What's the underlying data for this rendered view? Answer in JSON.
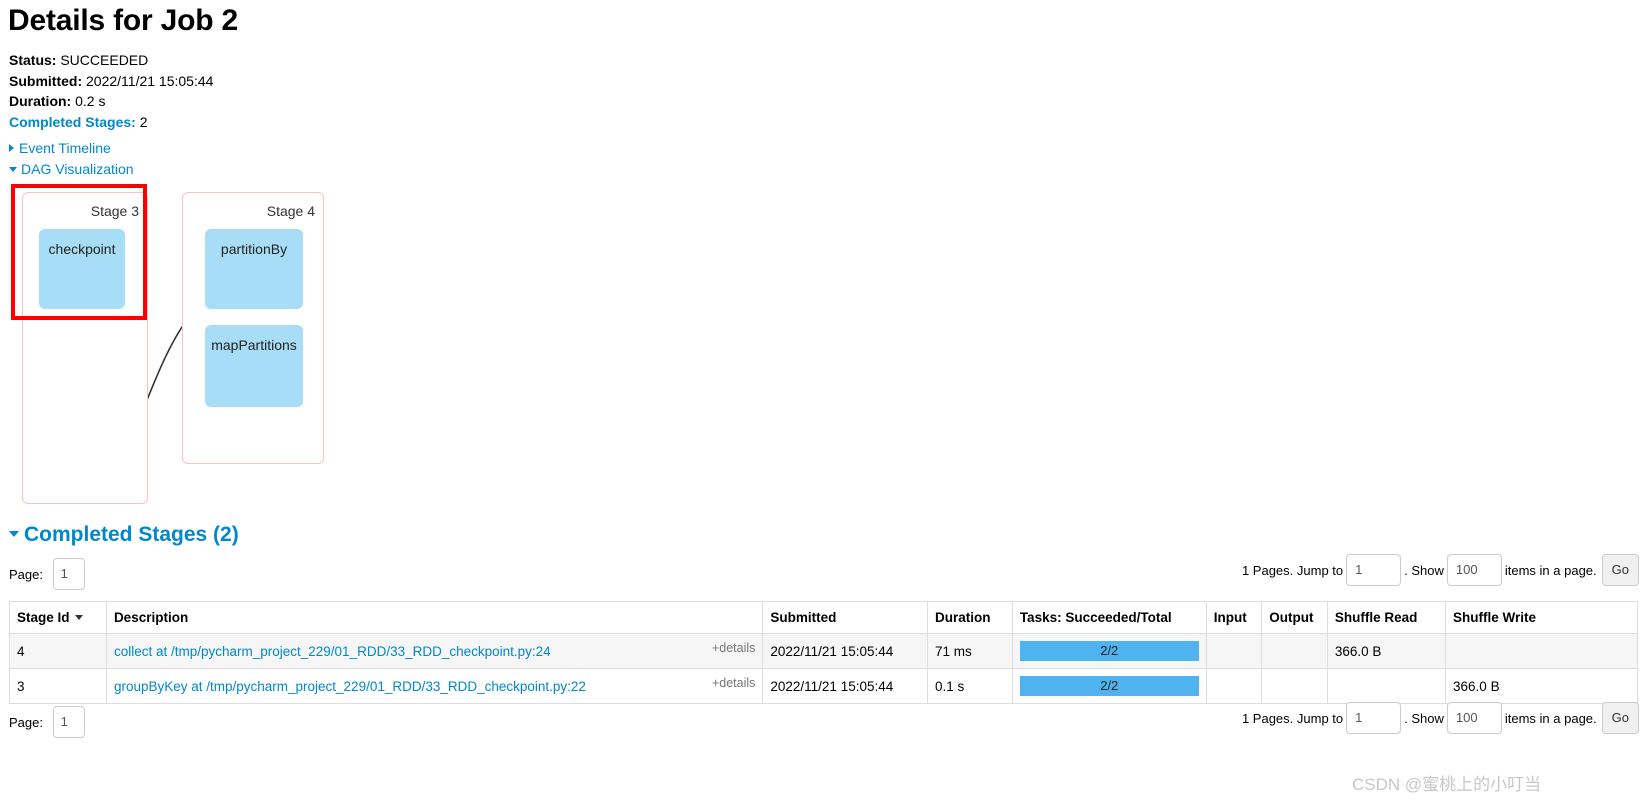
{
  "header": {
    "title": "Details for Job 2",
    "status_label": "Status:",
    "status_value": "SUCCEEDED",
    "submitted_label": "Submitted:",
    "submitted_value": "2022/11/21 15:05:44",
    "duration_label": "Duration:",
    "duration_value": "0.2 s",
    "completed_stages_label": "Completed Stages:",
    "completed_stages_value": "2"
  },
  "links": {
    "event_timeline": "Event Timeline",
    "dag_visualization": "DAG Visualization"
  },
  "dag": {
    "stages": [
      {
        "label": "Stage 3",
        "nodes": [
          {
            "label": "checkpoint"
          }
        ]
      },
      {
        "label": "Stage 4",
        "nodes": [
          {
            "label": "partitionBy"
          },
          {
            "label": "mapPartitions"
          }
        ]
      }
    ],
    "highlight_color": "#ff0000",
    "node_color": "#a7ddf7",
    "stage_border_color": "#fbbfc4"
  },
  "completed_stages_section": {
    "header": "Completed Stages (2)",
    "page_label": "Page:",
    "page_value": "1",
    "pager": {
      "pages_text": "1 Pages. Jump to",
      "jump_value": "1",
      "show_text": ". Show",
      "show_value": "100",
      "items_text": "items in a page.",
      "go_label": "Go"
    },
    "columns": [
      "Stage Id",
      "Description",
      "Submitted",
      "Duration",
      "Tasks: Succeeded/Total",
      "Input",
      "Output",
      "Shuffle Read",
      "Shuffle Write"
    ],
    "rows": [
      {
        "stage_id": "4",
        "description": "collect at /tmp/pycharm_project_229/01_RDD/33_RDD_checkpoint.py:24",
        "details": "+details",
        "submitted": "2022/11/21 15:05:44",
        "duration": "71 ms",
        "tasks": "2/2",
        "tasks_percent": 100,
        "input": "",
        "output": "",
        "shuffle_read": "366.0 B",
        "shuffle_write": ""
      },
      {
        "stage_id": "3",
        "description": "groupByKey at /tmp/pycharm_project_229/01_RDD/33_RDD_checkpoint.py:22",
        "details": "+details",
        "submitted": "2022/11/21 15:05:44",
        "duration": "0.1 s",
        "tasks": "2/2",
        "tasks_percent": 100,
        "input": "",
        "output": "",
        "shuffle_read": "",
        "shuffle_write": "366.0 B"
      }
    ]
  },
  "watermark": "CSDN @蜜桃上的小叮当",
  "colors": {
    "link": "#0088cc",
    "progress": "#4fb3ef",
    "node": "#a7ddf7",
    "highlight": "#ff0000"
  }
}
